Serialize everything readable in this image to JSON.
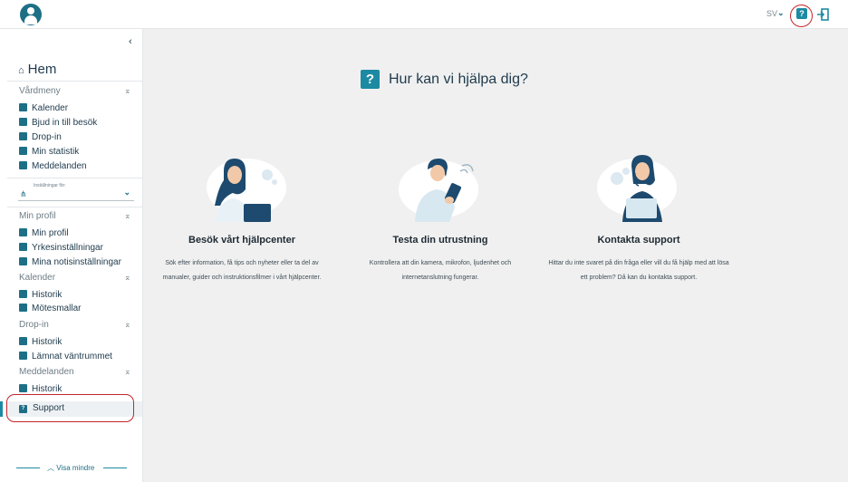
{
  "topbar": {
    "language": "SV",
    "help_label": "?"
  },
  "sidebar": {
    "collapse_label": "‹",
    "home_label": "Hem",
    "sections": {
      "vardmeny": {
        "title": "Vårdmeny",
        "items": [
          "Kalender",
          "Bjud in till besök",
          "Drop-in",
          "Min statistik",
          "Meddelanden"
        ]
      },
      "settings": {
        "label": "Inställningar för:"
      },
      "min_profil": {
        "title": "Min profil",
        "items": [
          "Min profil",
          "Yrkesinställningar",
          "Mina notisinställningar"
        ]
      },
      "kalender": {
        "title": "Kalender",
        "items": [
          "Historik",
          "Mötesmallar"
        ]
      },
      "drop_in": {
        "title": "Drop-in",
        "items": [
          "Historik",
          "Lämnat väntrummet"
        ]
      },
      "meddelanden": {
        "title": "Meddelanden",
        "items": [
          "Historik"
        ]
      }
    },
    "support_label": "Support",
    "show_less_label": "Visa mindre"
  },
  "main": {
    "title": "Hur kan vi hjälpa dig?",
    "cards": [
      {
        "title": "Besök vårt hjälpcenter",
        "description": "Sök efter information, få tips och nyheter eller ta del av manualer, guider och instruktionsfilmer i vårt hjälpcenter."
      },
      {
        "title": "Testa din utrustning",
        "description": "Kontrollera att din kamera, mikrofon, ljudenhet och internetanslutning fungerar."
      },
      {
        "title": "Kontakta support",
        "description": "Hittar du inte svaret på din fråga eller vill du få hjälp med att lösa ett problem? Då kan du kontakta support."
      }
    ]
  },
  "colors": {
    "accent": "#1d8aa3",
    "brand_dark": "#1d6f86",
    "highlight": "#c1272d"
  }
}
